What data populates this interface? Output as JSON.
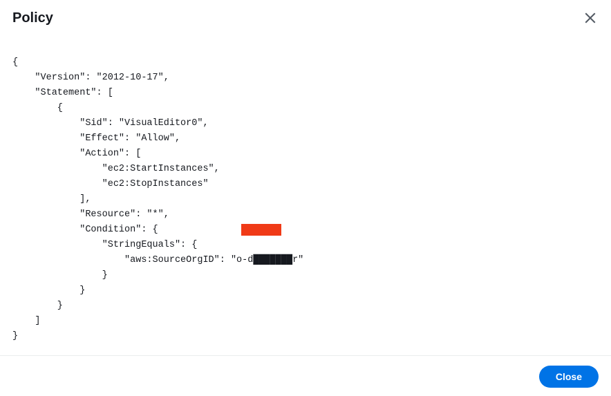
{
  "dialog": {
    "title": "Policy",
    "close_label": "Close"
  },
  "policy": {
    "l0": "{",
    "l1": "    \"Version\": \"2012-10-17\",",
    "l2": "    \"Statement\": [",
    "l3": "        {",
    "l4": "            \"Sid\": \"VisualEditor0\",",
    "l5": "            \"Effect\": \"Allow\",",
    "l6": "            \"Action\": [",
    "l7": "                \"ec2:StartInstances\",",
    "l8": "                \"ec2:StopInstances\"",
    "l9": "            ],",
    "l10": "            \"Resource\": \"*\",",
    "l11": "            \"Condition\": {",
    "l12": "                \"StringEquals\": {",
    "l13": "                    \"aws:SourceOrgID\": \"o-d███████r\"",
    "l14": "                }",
    "l15": "            }",
    "l16": "        }",
    "l17": "    ]",
    "l18": "}"
  }
}
